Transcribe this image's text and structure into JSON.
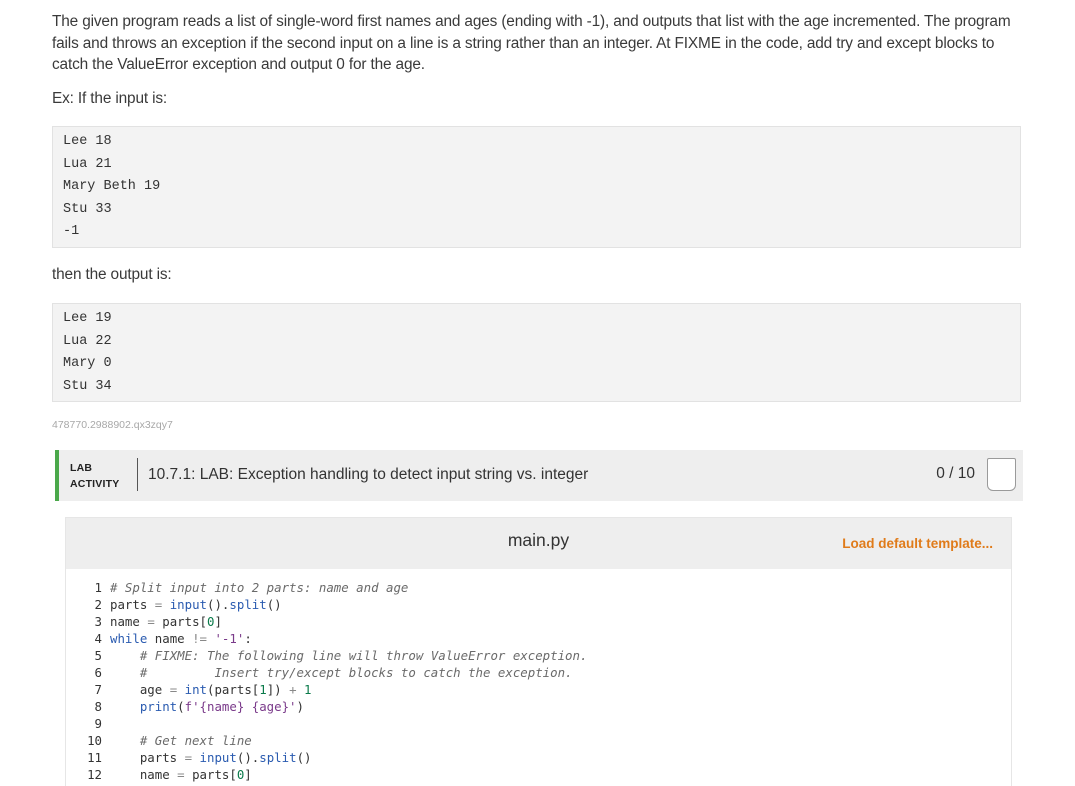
{
  "problem": {
    "intro": "The given program reads a list of single-word first names and ages (ending with -1), and outputs that list with the age incremented. The program fails and throws an exception if the second input on a line is a string rather than an integer. At FIXME in the code, add try and except blocks to catch the ValueError exception and output 0 for the age.",
    "example_label": "Ex: If the input is:",
    "input_lines": [
      "Lee 18",
      "Lua 21",
      "Mary Beth 19",
      "Stu 33",
      "-1"
    ],
    "then_label": "then the output is:",
    "output_lines": [
      "Lee 19",
      "Lua 22",
      "Mary 0",
      "Stu 34"
    ],
    "identifier": "478770.2988902.qx3zqy7"
  },
  "lab": {
    "tag_line1": "LAB",
    "tag_line2": "ACTIVITY",
    "title": "10.7.1: LAB: Exception handling to detect input string vs. integer",
    "score": "0 / 10"
  },
  "editor": {
    "file_name": "main.py",
    "load_template": "Load default template...",
    "line_numbers": [
      "1",
      "2",
      "3",
      "4",
      "5",
      "6",
      "7",
      "8",
      "9",
      "10",
      "11",
      "12"
    ]
  },
  "colors": {
    "accent_green": "#4aa84a",
    "link_orange": "#e07b1a"
  }
}
